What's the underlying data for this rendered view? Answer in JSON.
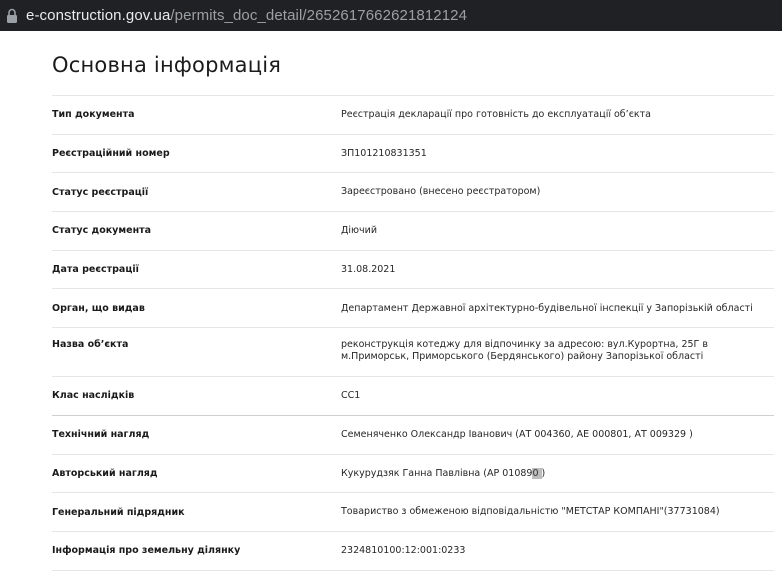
{
  "browser": {
    "url_host": "e-construction.gov.ua",
    "url_path": "/permits_doc_detail/2652617662621812124"
  },
  "page": {
    "title": "Основна інформація"
  },
  "rows": [
    {
      "label": "Тип документа",
      "value": "Реєстрація декларації про готовність до експлуатації об’єкта"
    },
    {
      "label": "Реєстраційний номер",
      "value": "ЗП101210831351"
    },
    {
      "label": "Статус реєстрації",
      "value": "Зареєстровано (внесено реєстратором)"
    },
    {
      "label": "Статус документа",
      "value": "Діючий"
    },
    {
      "label": "Дата реєстрації",
      "value": "31.08.2021"
    },
    {
      "label": "Орган, що видав",
      "value": "Департамент Державної архітектурно-будівельної інспекції у Запорізькій області"
    },
    {
      "label": "Назва об’єкта",
      "value": "реконструкція котеджу для відпочинку за адресою: вул.Курортна, 25Г в м.Приморськ, Приморського (Бердянського) району Запорізької області"
    },
    {
      "label": "Клас наслідків",
      "value": "СС1"
    },
    {
      "label": "Технічний нагляд",
      "value": "Семеняченко Олександр Іванович (АТ 004360, АЕ 000801, АТ 009329 )"
    },
    {
      "label": "Авторський нагляд",
      "value_pre": "Кукурудзяк Ганна Павлівна (АР 01089",
      "value_hl": "0 ",
      "value_post": ")"
    },
    {
      "label": "Генеральний підрядник",
      "value": "Товариство з обмеженою відповідальністю \"МЕТСТАР КОМПАНІ\"(37731084)"
    },
    {
      "label": "Інформація про земельну ділянку",
      "value": "2324810100:12:001:0233"
    }
  ]
}
